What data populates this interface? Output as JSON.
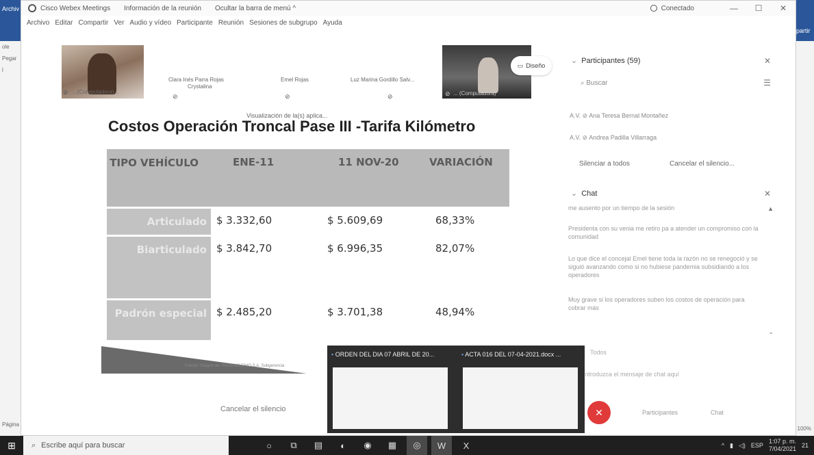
{
  "word_bg": {
    "top_label": "Archiv",
    "items": [
      "ole",
      "Pegar",
      "l"
    ],
    "page_label": "Página",
    "right_top_label": "partir",
    "zoom": "100%"
  },
  "webex": {
    "title": "Cisco Webex Meetings",
    "info": "Información de la reunión",
    "hide_menu": "Ocultar la barra de menú ^",
    "status": "Conectado",
    "win_min": "—",
    "win_max": "☐",
    "win_close": "✕",
    "menu": [
      "Archivo",
      "Editar",
      "Compartir",
      "Ver",
      "Audio y vídeo",
      "Participante",
      "Reunión",
      "Sesiones de subgrupo",
      "Ayuda"
    ]
  },
  "video_strip": {
    "tiles": [
      {
        "name": "...(Computadora)...",
        "mic": "⊘"
      },
      {
        "name": "Clara Inés Parra Rojas",
        "name2": "Crystalina",
        "mic": "⊘"
      },
      {
        "name": "Emel Rojas",
        "mic": "⊘"
      },
      {
        "name": "Luz Marina Gordillo Salv...",
        "mic": "⊘"
      },
      {
        "name": "... (Computadora)",
        "mic": "⊘"
      }
    ],
    "layout_label": "Diseño",
    "viewing_app": "Visualización de la(s) aplica..."
  },
  "slide": {
    "title": "Costos Operación Troncal Pase III -Tarifa Kilómetro",
    "headers": [
      "TIPO VEHÍCULO",
      "ENE-11",
      "11 NOV-20",
      "VARIACIÓN"
    ],
    "rows": [
      {
        "type": "Articulado",
        "ene": "$ 3.332,60",
        "nov": "$ 5.609,69",
        "var": "68,33%"
      },
      {
        "type": "Biarticulado",
        "ene": "$ 3.842,70",
        "nov": "$ 6.996,35",
        "var": "82,07%"
      },
      {
        "type": "Padrón especial",
        "ene": "$ 2.485,20",
        "nov": "$ 3.701,38",
        "var": "48,94%"
      }
    ],
    "footnote": "Fuente: Imagen de TRANSMILENIO S.A. Subgerencia"
  },
  "unmute_label": "Cancelar el silencio",
  "panel": {
    "participants_title": "Participantes (59)",
    "search_placeholder": "Buscar",
    "participants": [
      "A.V. ⊘  Ana Teresa Bernal Montañez",
      "A.V. ⊘  Andrea Padilla Villarraga"
    ],
    "mute_all": "Silenciar a todos",
    "unmute_all": "Cancelar el silencio...",
    "chat_title": "Chat",
    "messages": [
      "me ausento por un tiempo de la sesión",
      "Presidenta con su venia me retiro pa a atender un compromiso con la comunidad",
      "Lo que dice el concejal Emel tiene toda la razón no se renegoció y se siguió avanzando como si no hubiese pandemia subsidiando a los operadores",
      "Muy grave si los operadores suben los costos de operación para cobrar más"
    ],
    "chat_to": "Todos",
    "chat_input": "Introduzca el mensaje de chat aquí",
    "btn_participants": "Participantes",
    "btn_chat": "Chat"
  },
  "thumbs": [
    {
      "title": "ORDEN DEL DIA 07 ABRIL DE 20..."
    },
    {
      "title": "ACTA 016 DEL 07-04-2021.docx ..."
    }
  ],
  "taskbar": {
    "search_placeholder": "Escribe aquí para buscar",
    "lang": "ESP",
    "time": "1:07 p. m.",
    "date": "7/04/2021",
    "notif": "21"
  }
}
